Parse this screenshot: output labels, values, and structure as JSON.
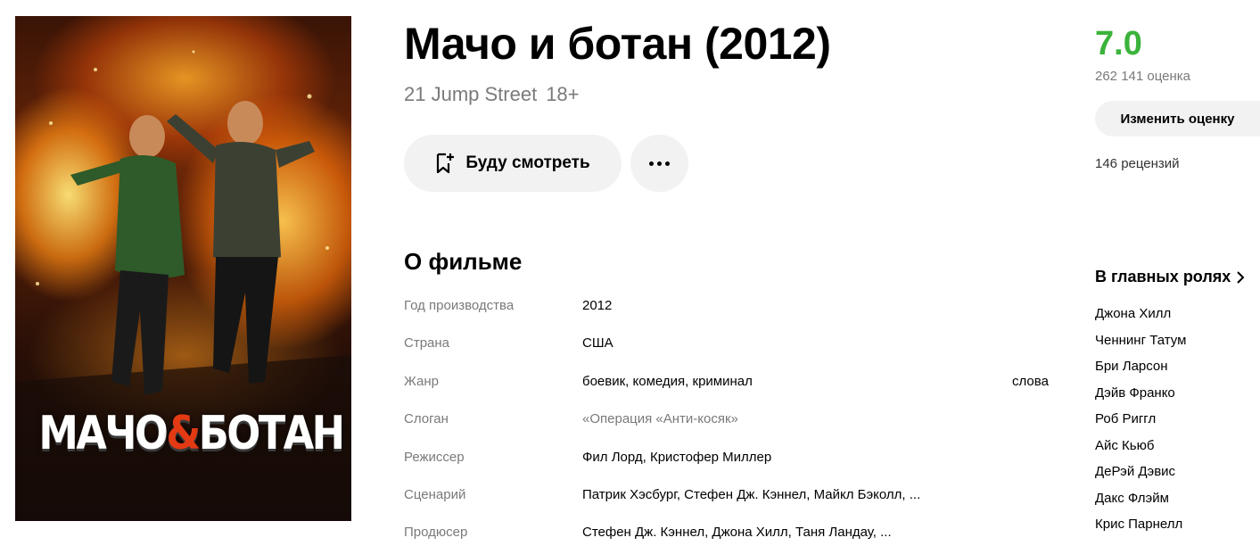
{
  "poster": {
    "title_left": "МАЧО",
    "title_amp": "&",
    "title_right": "БОТАН"
  },
  "movie": {
    "title": "Мачо и ботан (2012)",
    "original_title": "21 Jump Street",
    "age_rating": "18+"
  },
  "actions": {
    "watchlist_label": "Буду смотреть",
    "watchlist_icon": "bookmark-plus-icon",
    "more_icon": "more-dots-icon"
  },
  "about": {
    "title": "О фильме",
    "rows": [
      {
        "key": "Год производства",
        "value": "2012"
      },
      {
        "key": "Страна",
        "value": "США"
      },
      {
        "key": "Жанр",
        "value": "боевик, комедия, криминал"
      },
      {
        "key": "Слоган",
        "value": "«Операция «Анти-косяк»"
      },
      {
        "key": "Режиссер",
        "value": "Фил Лорд, Кристофер Миллер"
      },
      {
        "key": "Сценарий",
        "value": "Патрик Хэсбург, Стефен Дж. Кэннел, Майкл Бэколл, ..."
      },
      {
        "key": "Продюсер",
        "value": "Стефен Дж. Кэннел, Джона Хилл, Таня Ландау, ..."
      }
    ],
    "genre_extra": "слова"
  },
  "rating": {
    "value": "7.0",
    "votes": "262 141 оценка",
    "rate_button": "Изменить оценку",
    "reviews": "146 рецензий",
    "color": "#3bb33b"
  },
  "cast": {
    "title": "В главных ролях",
    "members": [
      "Джона Хилл",
      "Ченнинг Татум",
      "Бри Ларсон",
      "Дэйв Франко",
      "Роб Риггл",
      "Айс Кьюб",
      "ДеРэй Дэвис",
      "Дакс Флэйм",
      "Крис Парнелл"
    ]
  }
}
